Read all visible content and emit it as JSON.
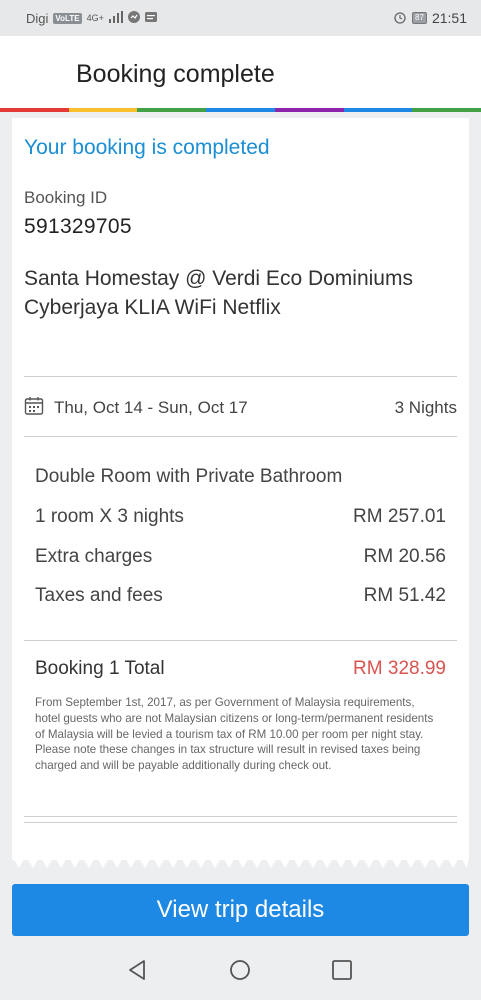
{
  "status_bar": {
    "carrier": "Digi",
    "volte": "VoLTE",
    "network": "4G+",
    "battery": "87",
    "time": "21:51"
  },
  "app_bar": {
    "title": "Booking complete"
  },
  "colors": {
    "accent": "#1b8ed4",
    "button": "#1e88e5",
    "total": "#d9534f",
    "rainbow": [
      "#e53935",
      "#fbc02d",
      "#43a047",
      "#1e88e5",
      "#8e24aa",
      "#1e88e5",
      "#43a047"
    ]
  },
  "booking": {
    "confirmation": "Your booking is completed",
    "id_label": "Booking ID",
    "id_value": "591329705",
    "hotel_name": "Santa Homestay @ Verdi Eco Dominiums Cyberjaya KLIA WiFi Netflix",
    "dates": "Thu, Oct 14 - Sun, Oct 17",
    "nights": "3 Nights",
    "room_type": "Double Room with Private Bathroom",
    "line_items": [
      {
        "label": "1 room X 3 nights",
        "value": "RM 257.01"
      },
      {
        "label": "Extra charges",
        "value": "RM 20.56"
      },
      {
        "label": "Taxes and fees",
        "value": "RM 51.42"
      }
    ],
    "total_label": "Booking 1 Total",
    "total_value": "RM 328.99",
    "tax_note": "From September 1st, 2017, as per Government of Malaysia requirements, hotel guests who are not Malaysian citizens or long-term/permanent residents of Malaysia will be levied a tourism tax of RM 10.00 per room per night stay. Please note these changes in tax structure will result in revised taxes being charged and will be payable additionally during check out."
  },
  "cta": {
    "label": "View trip details"
  },
  "icons": {
    "calendar": "calendar-icon",
    "back": "back-triangle-icon",
    "home": "home-circle-icon",
    "recents": "recents-square-icon"
  }
}
